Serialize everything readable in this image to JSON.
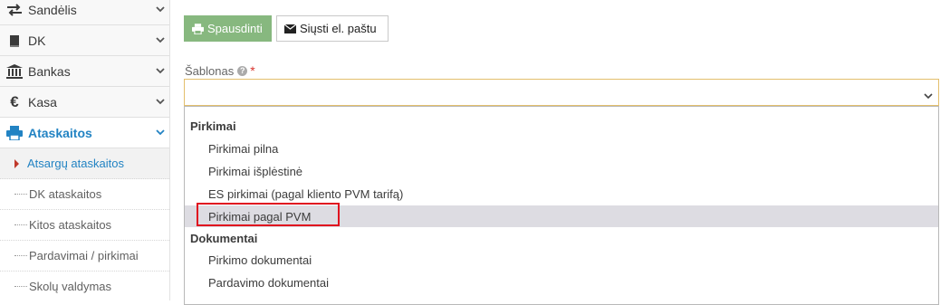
{
  "sidebar": {
    "items": [
      {
        "label": "Sandėlis",
        "icon": "exchange-arrows-icon"
      },
      {
        "label": "DK",
        "icon": "book-icon"
      },
      {
        "label": "Bankas",
        "icon": "bank-icon"
      },
      {
        "label": "Kasa",
        "icon": "euro-icon"
      },
      {
        "label": "Ataskaitos",
        "icon": "print-icon"
      }
    ],
    "sub_items": [
      {
        "label": "Atsargų ataskaitos"
      },
      {
        "label": "DK ataskaitos"
      },
      {
        "label": "Kitos ataskaitos"
      },
      {
        "label": "Pardavimai / pirkimai"
      },
      {
        "label": "Skolų valdymas"
      }
    ]
  },
  "toolbar": {
    "print_label": "Spausdinti",
    "email_label": "Siųsti el. paštu"
  },
  "form": {
    "template_label": "Šablonas",
    "required_mark": "*",
    "template_value": ""
  },
  "dropdown": {
    "groups": [
      {
        "label": "Pirkimai",
        "options": [
          "Pirkimai pilna",
          "Pirkimai išplėstinė",
          "ES pirkimai (pagal kliento PVM tarifą)",
          "Pirkimai pagal PVM"
        ]
      },
      {
        "label": "Dokumentai",
        "options": [
          "Pirkimo dokumentai",
          "Pardavimo dokumentai"
        ]
      }
    ],
    "highlighted": "Pirkimai pagal PVM"
  },
  "colors": {
    "accent": "#2283c3",
    "print_button": "#87b87f",
    "highlight_box": "#e0101f",
    "select_border": "#e3bf6c"
  }
}
